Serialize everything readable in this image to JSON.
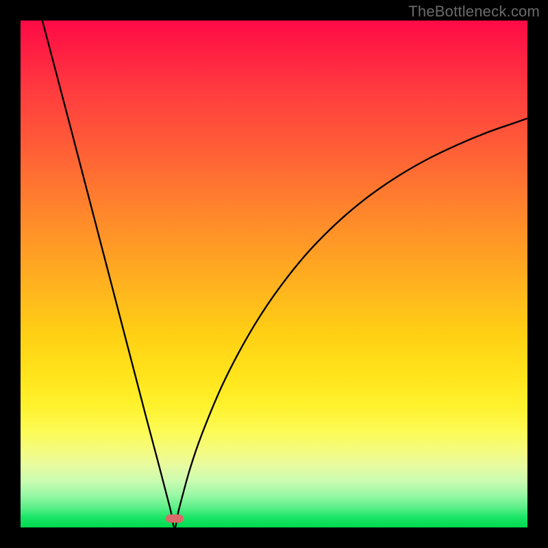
{
  "watermark": "TheBottleneck.com",
  "chart_data": {
    "type": "line",
    "title": "",
    "xlabel": "",
    "ylabel": "",
    "xlim": [
      0,
      1
    ],
    "ylim": [
      0,
      1
    ],
    "background_gradient": {
      "top": "#ff0a46",
      "mid_upper": "#ff9926",
      "mid": "#ffe41b",
      "mid_lower": "#f4fb80",
      "bottom": "#00d94e"
    },
    "optimum_x": 0.304,
    "marker": {
      "x": 0.304,
      "y": 0.017,
      "color": "#d96a6a"
    },
    "series": [
      {
        "name": "bottleneck-curve",
        "stroke": "#000000",
        "points": [
          {
            "x": 0.043,
            "y": 1.0
          },
          {
            "x": 0.07,
            "y": 0.898
          },
          {
            "x": 0.1,
            "y": 0.784
          },
          {
            "x": 0.13,
            "y": 0.669
          },
          {
            "x": 0.16,
            "y": 0.554
          },
          {
            "x": 0.19,
            "y": 0.439
          },
          {
            "x": 0.22,
            "y": 0.324
          },
          {
            "x": 0.25,
            "y": 0.209
          },
          {
            "x": 0.275,
            "y": 0.115
          },
          {
            "x": 0.295,
            "y": 0.038
          },
          {
            "x": 0.304,
            "y": 0.0
          },
          {
            "x": 0.313,
            "y": 0.038
          },
          {
            "x": 0.335,
            "y": 0.118
          },
          {
            "x": 0.36,
            "y": 0.19
          },
          {
            "x": 0.4,
            "y": 0.285
          },
          {
            "x": 0.45,
            "y": 0.38
          },
          {
            "x": 0.5,
            "y": 0.458
          },
          {
            "x": 0.56,
            "y": 0.535
          },
          {
            "x": 0.62,
            "y": 0.597
          },
          {
            "x": 0.68,
            "y": 0.648
          },
          {
            "x": 0.74,
            "y": 0.69
          },
          {
            "x": 0.8,
            "y": 0.725
          },
          {
            "x": 0.86,
            "y": 0.754
          },
          {
            "x": 0.92,
            "y": 0.779
          },
          {
            "x": 0.98,
            "y": 0.8
          },
          {
            "x": 1.0,
            "y": 0.807
          }
        ]
      }
    ]
  },
  "colors": {
    "frame": "#000000",
    "watermark": "#6b6b6b",
    "curve": "#000000",
    "marker": "#d96a6a"
  }
}
